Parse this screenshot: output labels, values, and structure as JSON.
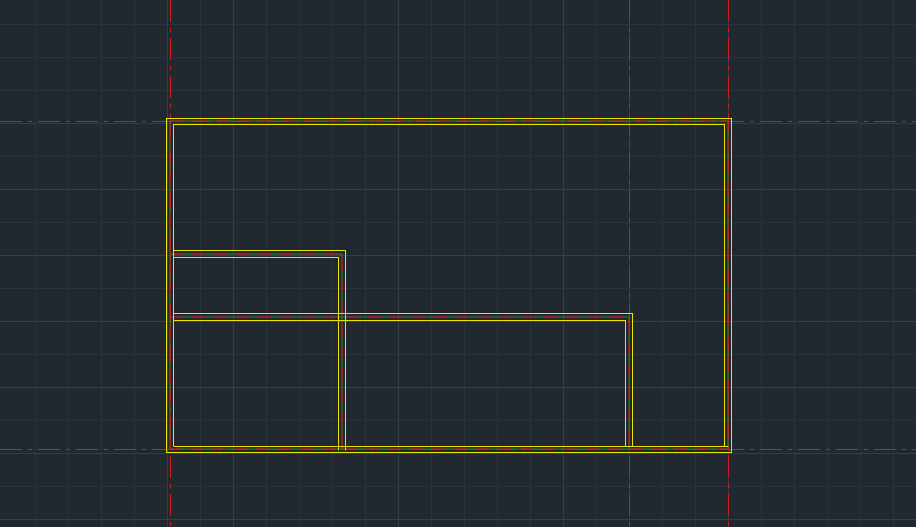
{
  "app": {
    "type": "cad-drawing-canvas"
  },
  "colors": {
    "background": "#212830",
    "grid_minor": "#2a323c",
    "grid_major": "#343d48",
    "axis_line": "#d01c1c",
    "wall_outline": "#e6e600",
    "wall_centerline_red": "#d01c1c",
    "wall_centerline_green": "#1f7a2a"
  },
  "drawing": {
    "layers": [
      "axis-lines",
      "walls"
    ],
    "axis_line_style": "dash-dot",
    "wall_style": "double-line"
  }
}
